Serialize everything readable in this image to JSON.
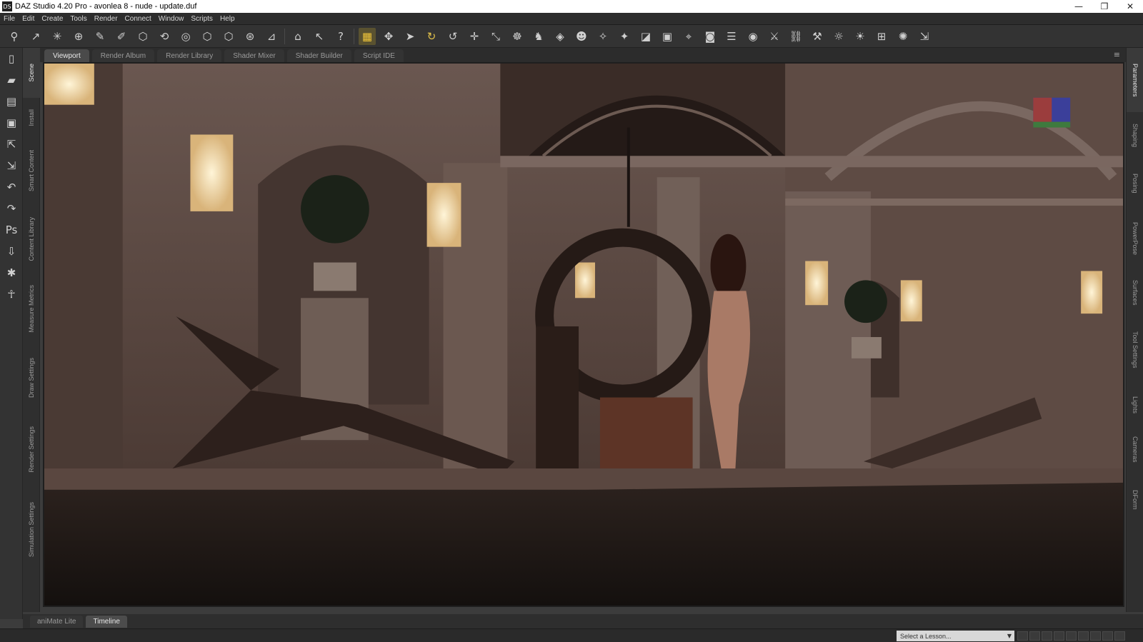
{
  "window": {
    "app_icon": "DS",
    "title": "DAZ Studio 4.20 Pro - avonlea 8 - nude - update.duf",
    "minimize": "—",
    "restore": "❐",
    "close": "✕"
  },
  "menubar": {
    "items": [
      "File",
      "Edit",
      "Create",
      "Tools",
      "Render",
      "Connect",
      "Window",
      "Scripts",
      "Help"
    ]
  },
  "toolbar": {
    "icons": [
      {
        "name": "node-selection-icon",
        "glyph": "⚲"
      },
      {
        "name": "joint-editor-icon",
        "glyph": "↗"
      },
      {
        "name": "node-weight-map-icon",
        "glyph": "✳"
      },
      {
        "name": "geometry-editor-icon",
        "glyph": "⊕"
      },
      {
        "name": "weight-brush-icon",
        "glyph": "✎"
      },
      {
        "name": "geometry-sculptor-icon",
        "glyph": "✐"
      },
      {
        "name": "spot-render-icon",
        "glyph": "⬡"
      },
      {
        "name": "scene-navigator-icon",
        "glyph": "⟲"
      },
      {
        "name": "surface-selection-icon",
        "glyph": "◎"
      },
      {
        "name": "region-navigator-icon",
        "glyph": "⬡"
      },
      {
        "name": "active-pose-icon",
        "glyph": "⬡"
      },
      {
        "name": "transform-icon",
        "glyph": "⊛"
      },
      {
        "name": "ruler-icon",
        "glyph": "⊿"
      },
      {
        "name": "home-icon",
        "glyph": "⌂"
      },
      {
        "name": "whats-this-icon",
        "glyph": "↖"
      },
      {
        "name": "help-icon",
        "glyph": "?"
      },
      {
        "name": "grid-icon",
        "glyph": "▦"
      },
      {
        "name": "universal-tool-icon",
        "glyph": "✥"
      },
      {
        "name": "pointer-icon",
        "glyph": "➤"
      },
      {
        "name": "rotate-yellow-icon",
        "glyph": "↻"
      },
      {
        "name": "rotate-icon",
        "glyph": "↺"
      },
      {
        "name": "translate-icon",
        "glyph": "✛"
      },
      {
        "name": "scale-icon",
        "glyph": "⤡"
      },
      {
        "name": "figure-pose-icon",
        "glyph": "☸"
      },
      {
        "name": "powerpose-icon",
        "glyph": "♞"
      },
      {
        "name": "surface-icon",
        "glyph": "◈"
      },
      {
        "name": "figure-setup-icon",
        "glyph": "☻"
      },
      {
        "name": "morph-brush-icon",
        "glyph": "✧"
      },
      {
        "name": "mesh-grabber-icon",
        "glyph": "✦"
      },
      {
        "name": "edit-polygon-icon",
        "glyph": "◪"
      },
      {
        "name": "camera-cube-icon",
        "glyph": "▣"
      },
      {
        "name": "aim-icon",
        "glyph": "⌖"
      },
      {
        "name": "camera-icon",
        "glyph": "◙"
      },
      {
        "name": "align-icon",
        "glyph": "☰"
      },
      {
        "name": "render-settings-icon",
        "glyph": "◉"
      },
      {
        "name": "bone-tool-icon",
        "glyph": "⚔"
      },
      {
        "name": "link-icon",
        "glyph": "⛓"
      },
      {
        "name": "joint-icon",
        "glyph": "⚒"
      },
      {
        "name": "light-icon",
        "glyph": "☼"
      },
      {
        "name": "spotlight-icon",
        "glyph": "☀"
      },
      {
        "name": "render-region-icon",
        "glyph": "⊞"
      },
      {
        "name": "iray-icon",
        "glyph": "✺"
      },
      {
        "name": "export-icon",
        "glyph": "⇲"
      }
    ]
  },
  "left_tools": {
    "icons": [
      {
        "name": "new-scene-icon",
        "glyph": "▯"
      },
      {
        "name": "open-icon",
        "glyph": "▰"
      },
      {
        "name": "merge-icon",
        "glyph": "▤"
      },
      {
        "name": "save-icon",
        "glyph": "▣"
      },
      {
        "name": "import-icon",
        "glyph": "⇱"
      },
      {
        "name": "export-file-icon",
        "glyph": "⇲"
      },
      {
        "name": "undo-icon",
        "glyph": "↶"
      },
      {
        "name": "redo-icon",
        "glyph": "↷"
      },
      {
        "name": "photoshop-bridge-icon",
        "glyph": "Ps"
      },
      {
        "name": "drop-to-floor-icon",
        "glyph": "⇩"
      },
      {
        "name": "pose-figure-icon",
        "glyph": "✱"
      },
      {
        "name": "figure-icon",
        "glyph": "☥"
      }
    ]
  },
  "left_vertical_tabs": [
    "Scene",
    "Install",
    "Smart Content",
    "Content Library",
    "Measure Metrics",
    "Draw Settings",
    "Render Settings",
    "Simulation Settings"
  ],
  "right_vertical_tabs": [
    "Parameters",
    "Shaping",
    "Posing",
    "PowerPose",
    "Surfaces",
    "Tool Settings",
    "Lights",
    "Cameras",
    "DForm"
  ],
  "pane_tabs": [
    "Viewport",
    "Render Album",
    "Render Library",
    "Shader Mixer",
    "Shader Builder",
    "Script IDE"
  ],
  "active_pane_tab": 0,
  "bottom_tabs": [
    "aniMate Lite",
    "Timeline"
  ],
  "active_bottom_tab": 1,
  "status": {
    "lesson_placeholder": "Select a Lesson...",
    "lesson_arrow": "▼",
    "pane_menu": "≡"
  },
  "colors": {
    "accent": "#e3c24a",
    "background": "#333333",
    "viewport_wall": "#5a4740"
  }
}
